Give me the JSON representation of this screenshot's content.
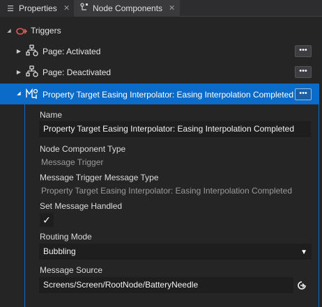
{
  "tabs": [
    {
      "label": "Properties",
      "icon": "list-icon",
      "close": "✕"
    },
    {
      "label": "Node Components",
      "icon": "node-components-icon",
      "close": "✕"
    }
  ],
  "tree": {
    "root_label": "Triggers",
    "items": [
      {
        "label": "Page: Activated",
        "more": "•••"
      },
      {
        "label": "Page: Deactivated",
        "more": "•••"
      },
      {
        "label": "Property Target Easing Interpolator: Easing Interpolation Completed",
        "more": "•••"
      }
    ]
  },
  "details": {
    "name_label": "Name",
    "name_value": "Property Target Easing Interpolator: Easing Interpolation Completed",
    "type_label": "Node Component Type",
    "type_value": "Message Trigger",
    "msg_type_label": "Message Trigger Message Type",
    "msg_type_value": "Property Target Easing Interpolator: Easing Interpolation Completed",
    "handled_label": "Set Message Handled",
    "handled_check": "✓",
    "routing_label": "Routing Mode",
    "routing_value": "Bubbling",
    "source_label": "Message Source",
    "source_value": "Screens/Screen/RootNode/BatteryNeedle"
  },
  "colors": {
    "accent": "#0a6bc9",
    "trigger_icon": "#e05a5a",
    "background": "#252526"
  }
}
